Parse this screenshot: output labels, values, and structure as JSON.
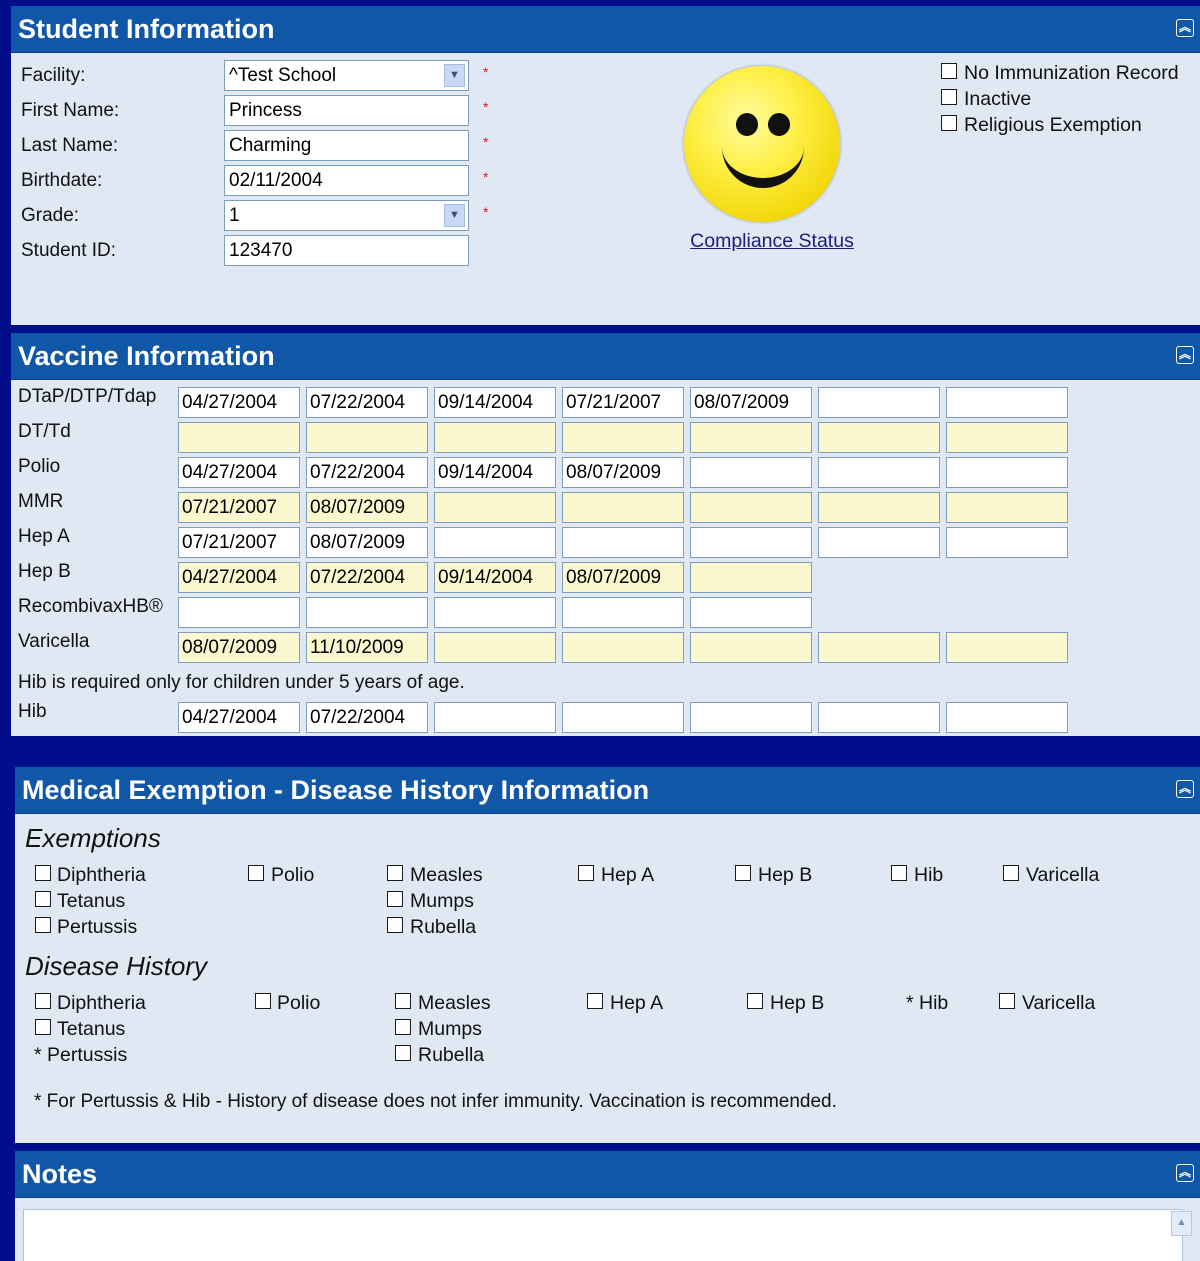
{
  "student": {
    "title": "Student Information",
    "collapse_icon": "double-chevron-up-icon",
    "labels": {
      "facility": "Facility:",
      "first_name": "First Name:",
      "last_name": "Last Name:",
      "birthdate": "Birthdate:",
      "grade": "Grade:",
      "student_id": "Student ID:"
    },
    "values": {
      "facility": "^Test School",
      "first_name": "Princess",
      "last_name": "Charming",
      "birthdate": "02/11/2004",
      "grade": "1",
      "student_id": "123470"
    },
    "required_marker": "*",
    "compliance_link": "Compliance Status",
    "compliance_icon": "smiley-face-icon",
    "checkboxes": [
      "No Immunization Record",
      "Inactive",
      "Religious Exemption"
    ]
  },
  "vaccine": {
    "title": "Vaccine Information",
    "note": "Hib is required only for children under 5 years of age.",
    "rows": [
      {
        "name": "DTaP/DTP/Tdap",
        "cells": [
          "04/27/2004",
          "07/22/2004",
          "09/14/2004",
          "07/21/2007",
          "08/07/2009",
          "",
          ""
        ],
        "highlight": false
      },
      {
        "name": "DT/Td",
        "cells": [
          "",
          "",
          "",
          "",
          "",
          "",
          ""
        ],
        "highlight": true
      },
      {
        "name": "Polio",
        "cells": [
          "04/27/2004",
          "07/22/2004",
          "09/14/2004",
          "08/07/2009",
          "",
          "",
          ""
        ],
        "highlight": false
      },
      {
        "name": "MMR",
        "cells": [
          "07/21/2007",
          "08/07/2009",
          "",
          "",
          "",
          "",
          ""
        ],
        "highlight": true
      },
      {
        "name": "Hep A",
        "cells": [
          "07/21/2007",
          "08/07/2009",
          "",
          "",
          "",
          "",
          ""
        ],
        "highlight": false
      },
      {
        "name": "Hep B",
        "cells": [
          "04/27/2004",
          "07/22/2004",
          "09/14/2004",
          "08/07/2009",
          ""
        ],
        "highlight": true
      },
      {
        "name": "RecombivaxHB®",
        "cells": [
          "",
          "",
          "",
          "",
          ""
        ],
        "highlight": false
      },
      {
        "name": "Varicella",
        "cells": [
          "08/07/2009",
          "11/10/2009",
          "",
          "",
          "",
          "",
          ""
        ],
        "highlight": true
      },
      {
        "name": "Hib",
        "cells": [
          "04/27/2004",
          "07/22/2004",
          "",
          "",
          "",
          "",
          ""
        ],
        "highlight": false
      }
    ],
    "colors": {
      "highlight": "#fbf8cf",
      "plain": "#ffffff"
    }
  },
  "medical": {
    "title": "Medical Exemption - Disease History Information",
    "exemptions_title": "Exemptions",
    "disease_history_title": "Disease History",
    "exemptions": {
      "diphtheria": "Diphtheria",
      "tetanus": "Tetanus",
      "pertussis": "Pertussis",
      "polio": "Polio",
      "measles": "Measles",
      "mumps": "Mumps",
      "rubella": "Rubella",
      "hep_a": "Hep A",
      "hep_b": "Hep B",
      "hib": "Hib",
      "varicella": "Varicella"
    },
    "history": {
      "diphtheria": "Diphtheria",
      "tetanus": "Tetanus",
      "pertussis": "* Pertussis",
      "polio": "Polio",
      "measles": "Measles",
      "mumps": "Mumps",
      "rubella": "Rubella",
      "hep_a": "Hep A",
      "hep_b": "Hep B",
      "hib": "* Hib",
      "varicella": "Varicella"
    },
    "footnote": "* For Pertussis & Hib - History of disease does not infer immunity. Vaccination is recommended."
  },
  "notes": {
    "title": "Notes",
    "value": ""
  },
  "colors": {
    "background": "#000e8c",
    "header": "#1157a8",
    "panel": "#dfe8f3",
    "required": "#d32020",
    "link": "#1a1e7a"
  }
}
